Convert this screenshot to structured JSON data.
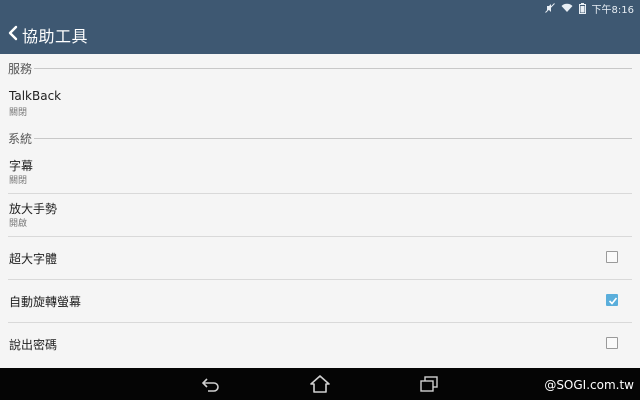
{
  "status_bar": {
    "time": "下午8:16",
    "icons": [
      "mute-icon",
      "wifi-icon",
      "battery-icon"
    ]
  },
  "header": {
    "back_icon": "chevron-left-icon",
    "title": "協助工具",
    "background": "#3e5872"
  },
  "sections": [
    {
      "label": "服務",
      "items": [
        {
          "title": "TalkBack",
          "subtitle": "關閉"
        }
      ]
    },
    {
      "label": "系統",
      "items": [
        {
          "title": "字幕",
          "subtitle": "關閉"
        },
        {
          "title": "放大手勢",
          "subtitle": "開啟"
        },
        {
          "title": "超大字體",
          "checked": false
        },
        {
          "title": "自動旋轉螢幕",
          "checked": true
        },
        {
          "title": "說出密碼",
          "checked": false
        }
      ]
    }
  ],
  "nav_bar": {
    "buttons": [
      "back-icon",
      "home-icon",
      "recent-apps-icon"
    ]
  },
  "watermark": "@SOGI.com.tw",
  "colors": {
    "accent": "#5aaedb",
    "nav_bg": "#050505"
  }
}
